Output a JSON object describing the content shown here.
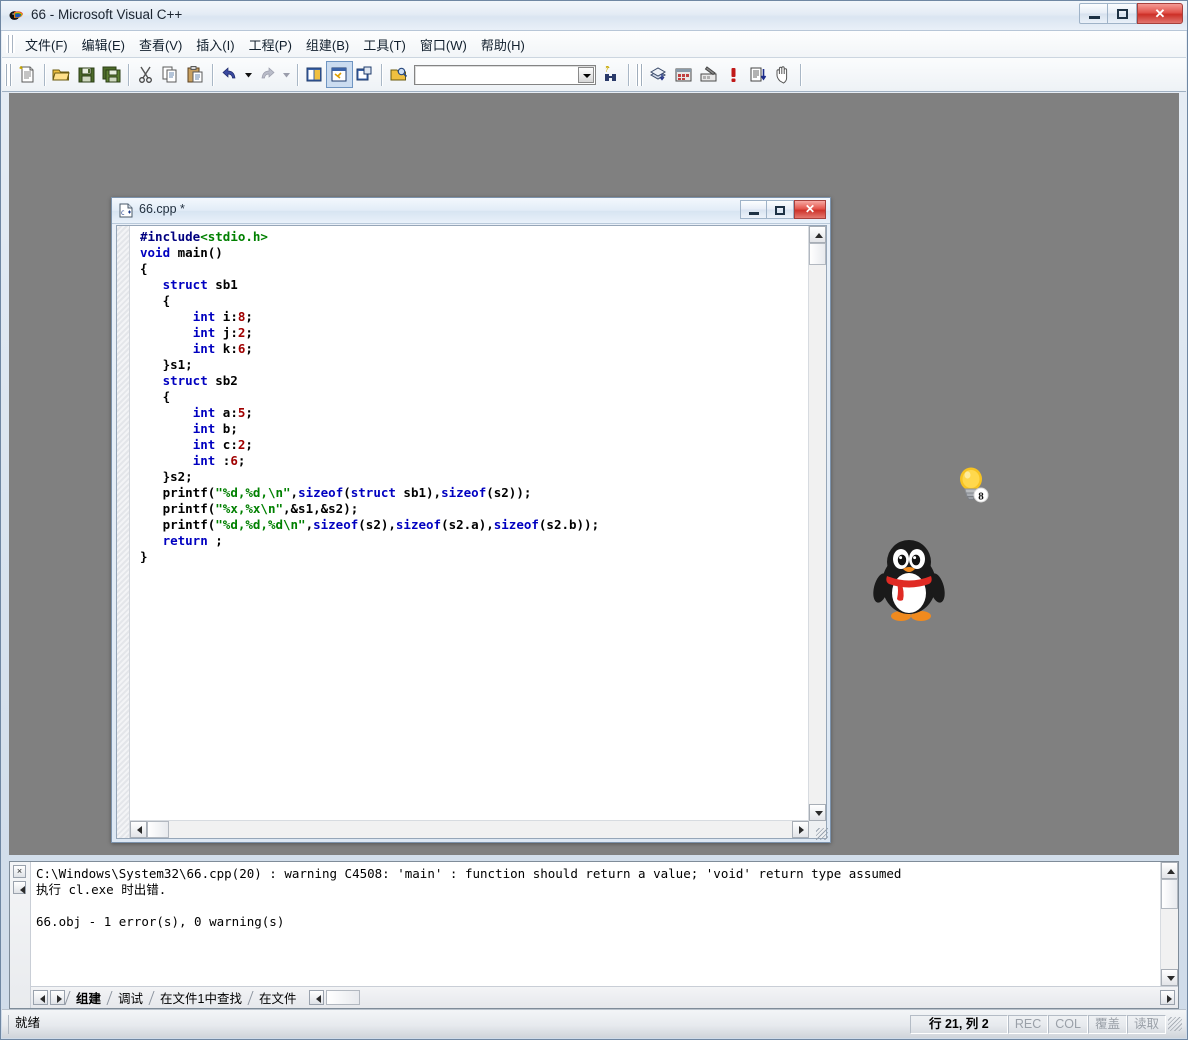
{
  "window": {
    "title": "66 - Microsoft Visual C++",
    "icon": "vcpp-app-icon",
    "controls": {
      "minimize": "minimize-button",
      "maximize": "maximize-button",
      "close": "close-button"
    }
  },
  "menubar": {
    "items": [
      {
        "label": "文件(F)",
        "name": "menu-file"
      },
      {
        "label": "编辑(E)",
        "name": "menu-edit"
      },
      {
        "label": "查看(V)",
        "name": "menu-view"
      },
      {
        "label": "插入(I)",
        "name": "menu-insert"
      },
      {
        "label": "工程(P)",
        "name": "menu-project"
      },
      {
        "label": "组建(B)",
        "name": "menu-build"
      },
      {
        "label": "工具(T)",
        "name": "menu-tools"
      },
      {
        "label": "窗口(W)",
        "name": "menu-window"
      },
      {
        "label": "帮助(H)",
        "name": "menu-help"
      }
    ]
  },
  "toolbar": {
    "standard": [
      "new-file-icon",
      "open-file-icon",
      "save-icon",
      "save-all-icon",
      "cut-icon",
      "copy-icon",
      "paste-icon",
      "undo-icon",
      "undo-dropdown-icon",
      "redo-icon",
      "redo-dropdown-icon",
      "workspace-toggle-icon",
      "output-toggle-icon",
      "watch-toggle-icon",
      "find-in-files-icon"
    ],
    "find_combo": {
      "value": "",
      "placeholder": ""
    },
    "search_button": "find-binoculars-icon",
    "build": [
      "compile-icon",
      "build-icon",
      "stop-build-icon",
      "execute-program-icon",
      "go-debug-icon",
      "insert-breakpoint-icon"
    ]
  },
  "child_window": {
    "title": "66.cpp *",
    "icon": "cpp-document-icon",
    "controls": {
      "minimize": "minimize-button",
      "maximize": "maximize-button",
      "close": "close-button"
    }
  },
  "code": {
    "lines": [
      [
        [
          "pp",
          "#include"
        ],
        [
          "str",
          "<stdio.h>"
        ]
      ],
      [
        [
          "kw",
          "void"
        ],
        [
          "pl",
          " main()"
        ]
      ],
      [
        [
          "pl",
          "{"
        ]
      ],
      [
        [
          "pl",
          "   "
        ],
        [
          "kw",
          "struct"
        ],
        [
          "pl",
          " sb1"
        ]
      ],
      [
        [
          "pl",
          "   {"
        ]
      ],
      [
        [
          "pl",
          "       "
        ],
        [
          "kw",
          "int"
        ],
        [
          "pl",
          " i:"
        ],
        [
          "num",
          "8"
        ],
        [
          "pl",
          ";"
        ]
      ],
      [
        [
          "pl",
          "       "
        ],
        [
          "kw",
          "int"
        ],
        [
          "pl",
          " j:"
        ],
        [
          "num",
          "2"
        ],
        [
          "pl",
          ";"
        ]
      ],
      [
        [
          "pl",
          "       "
        ],
        [
          "kw",
          "int"
        ],
        [
          "pl",
          " k:"
        ],
        [
          "num",
          "6"
        ],
        [
          "pl",
          ";"
        ]
      ],
      [
        [
          "pl",
          "   }s1;"
        ]
      ],
      [
        [
          "pl",
          "   "
        ],
        [
          "kw",
          "struct"
        ],
        [
          "pl",
          " sb2"
        ]
      ],
      [
        [
          "pl",
          "   {"
        ]
      ],
      [
        [
          "pl",
          "       "
        ],
        [
          "kw",
          "int"
        ],
        [
          "pl",
          " a:"
        ],
        [
          "num",
          "5"
        ],
        [
          "pl",
          ";"
        ]
      ],
      [
        [
          "pl",
          "       "
        ],
        [
          "kw",
          "int"
        ],
        [
          "pl",
          " b;"
        ]
      ],
      [
        [
          "pl",
          "       "
        ],
        [
          "kw",
          "int"
        ],
        [
          "pl",
          " c:"
        ],
        [
          "num",
          "2"
        ],
        [
          "pl",
          ";"
        ]
      ],
      [
        [
          "pl",
          "       "
        ],
        [
          "kw",
          "int"
        ],
        [
          "pl",
          " :"
        ],
        [
          "num",
          "6"
        ],
        [
          "pl",
          ";"
        ]
      ],
      [
        [
          "pl",
          "   }s2;"
        ]
      ],
      [
        [
          "pl",
          "   printf("
        ],
        [
          "str",
          "\"%d,%d,\\n\""
        ],
        [
          "pl",
          ","
        ],
        [
          "kw",
          "sizeof"
        ],
        [
          "pl",
          "("
        ],
        [
          "kw",
          "struct"
        ],
        [
          "pl",
          " sb1),"
        ],
        [
          "kw",
          "sizeof"
        ],
        [
          "pl",
          "(s2));"
        ]
      ],
      [
        [
          "pl",
          "   printf("
        ],
        [
          "str",
          "\"%x,%x\\n\""
        ],
        [
          "pl",
          ",&s1,&s2);"
        ]
      ],
      [
        [
          "pl",
          "   printf("
        ],
        [
          "str",
          "\"%d,%d,%d\\n\""
        ],
        [
          "pl",
          ","
        ],
        [
          "kw",
          "sizeof"
        ],
        [
          "pl",
          "(s2),"
        ],
        [
          "kw",
          "sizeof"
        ],
        [
          "pl",
          "(s2.a),"
        ],
        [
          "kw",
          "sizeof"
        ],
        [
          "pl",
          "(s2.b));"
        ]
      ],
      [
        [
          "pl",
          "   "
        ],
        [
          "kw",
          "return"
        ],
        [
          "pl",
          " ;"
        ]
      ],
      [
        [
          "pl",
          "}"
        ]
      ]
    ]
  },
  "output": {
    "lines": [
      "C:\\Windows\\System32\\66.cpp(20) : warning C4508: 'main' : function should return a value; 'void' return type assumed",
      "执行 cl.exe 时出错.",
      "",
      "66.obj - 1 error(s), 0 warning(s)"
    ],
    "close_button": "×",
    "tabs": [
      {
        "label": "组建",
        "active": true
      },
      {
        "label": "调试",
        "active": false
      },
      {
        "label": "在文件1中查找",
        "active": false
      },
      {
        "label": "在文件",
        "active": false
      }
    ]
  },
  "statusbar": {
    "message": "就绪",
    "position": "行 21, 列 2",
    "indicators": [
      "REC",
      "COL",
      "覆盖",
      "读取"
    ]
  },
  "desktop": {
    "qq_mascot": "qq-penguin-icon",
    "bulb_badge": {
      "name": "lightbulb-icon",
      "count": "8"
    }
  },
  "colors": {
    "keyword": "#0000c0",
    "string": "#008000",
    "number": "#a00000",
    "desktop": "#808080",
    "accent": "#cc2f27"
  }
}
